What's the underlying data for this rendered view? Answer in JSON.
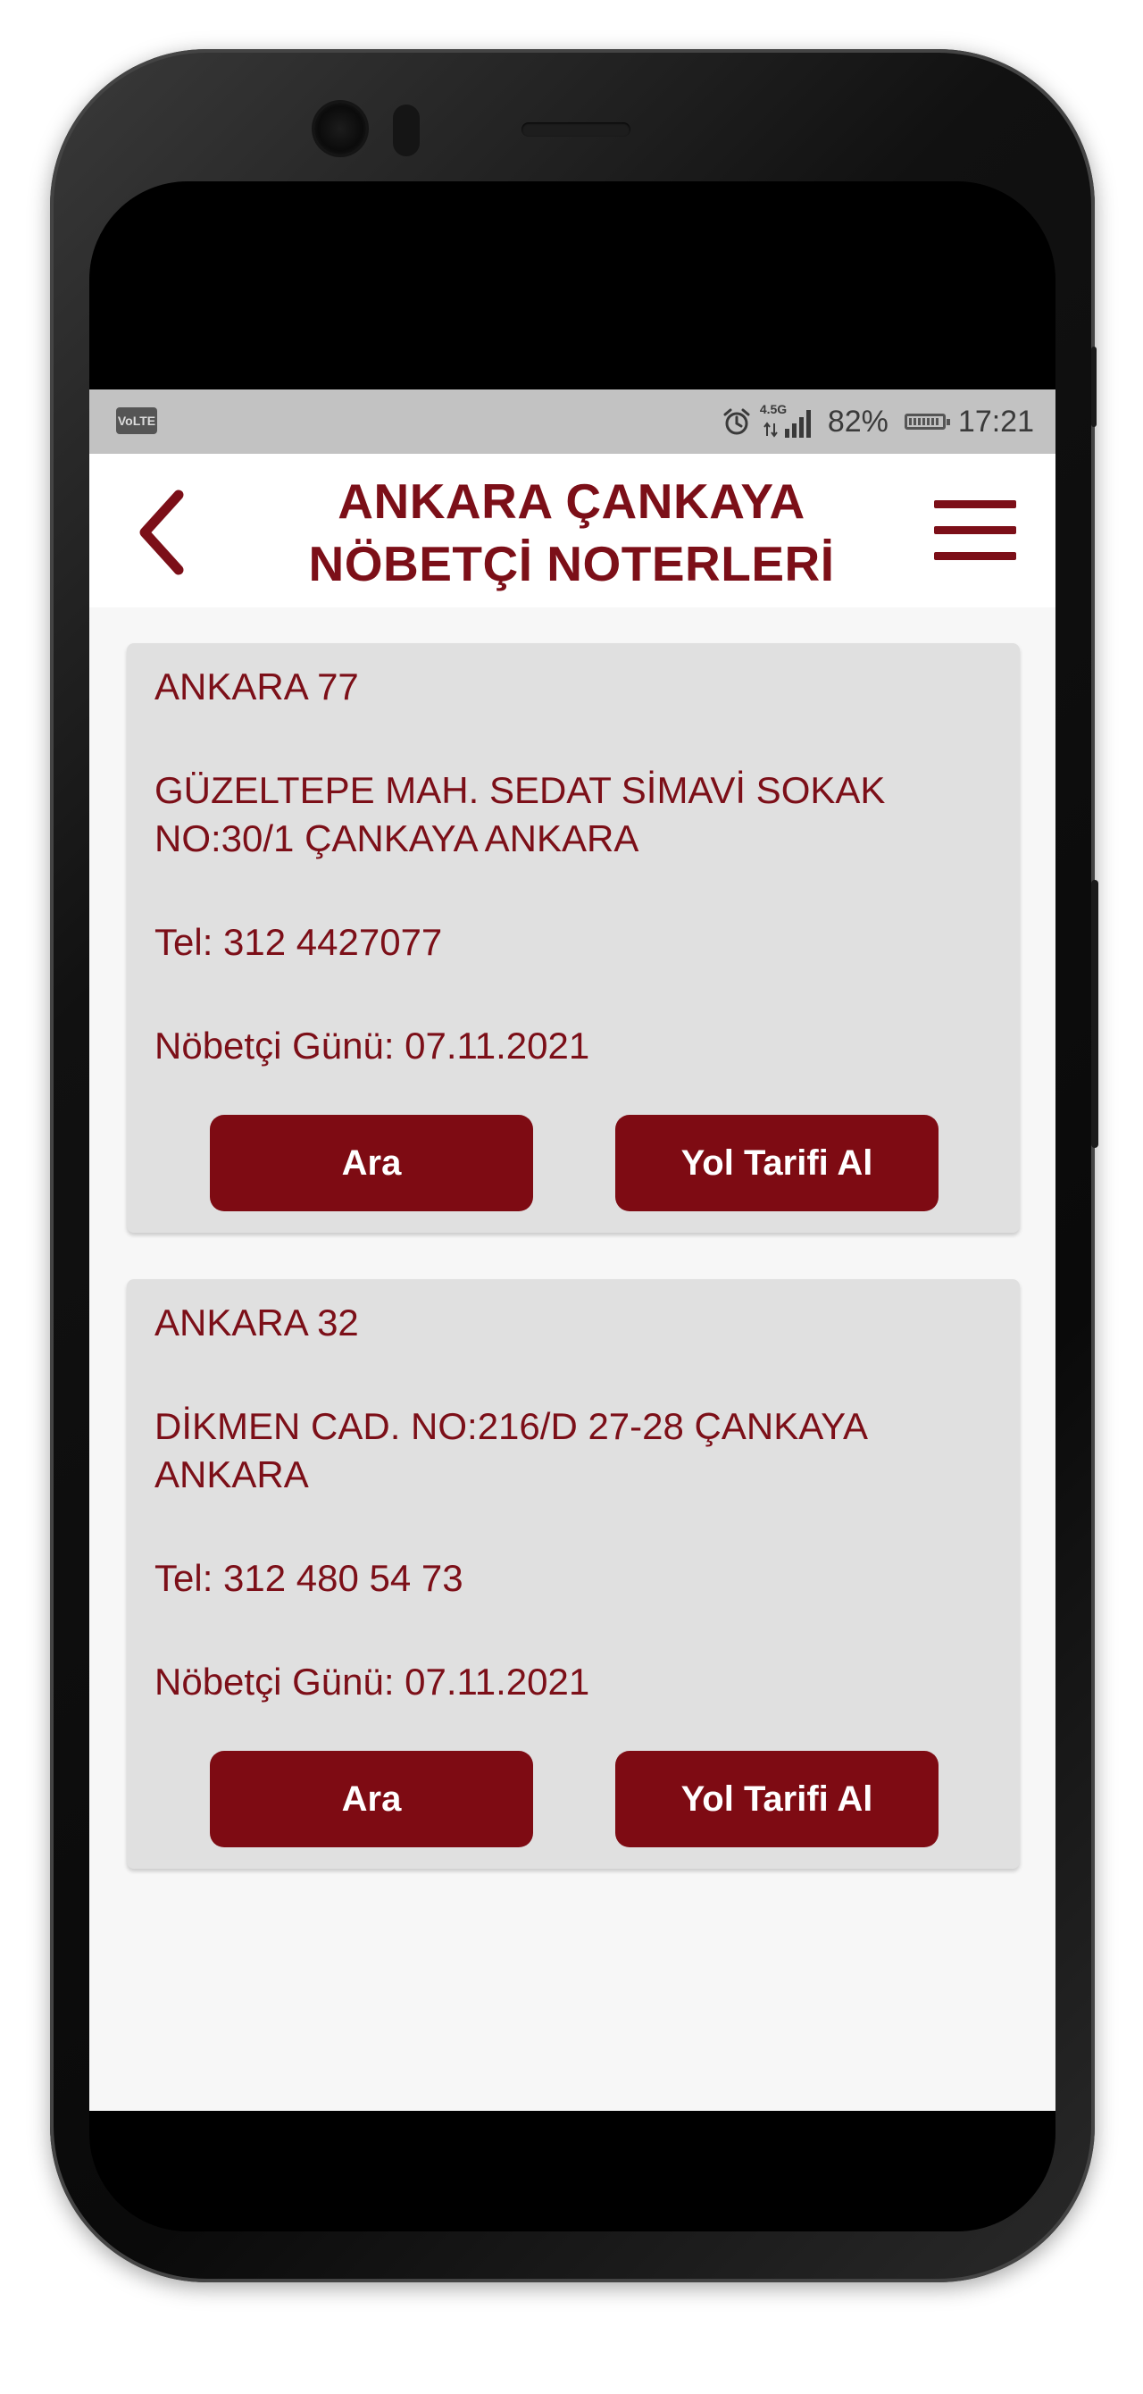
{
  "status_bar": {
    "network_badge": "VoLTE",
    "network_type": "4.5G",
    "battery": "82%",
    "time": "17:21",
    "icons": [
      "alarm-icon",
      "signal-icon",
      "battery-icon"
    ]
  },
  "header": {
    "title_line1": "ANKARA ÇANKAYA",
    "title_line2": "NÖBETÇİ NOTERLERİ",
    "back_icon": "chevron-left-icon",
    "menu_icon": "hamburger-menu-icon"
  },
  "notaries": [
    {
      "name": "ANKARA 77",
      "address_line1": "GÜZELTEPE MAH. SEDAT SİMAVİ SOKAK",
      "address_line2": "NO:30/1 ÇANKAYA ANKARA",
      "phone": "Tel: 312 4427077",
      "duty_day": "Nöbetçi Günü: 07.11.2021",
      "call_label": "Ara",
      "route_label": "Yol Tarifi Al"
    },
    {
      "name": "ANKARA 32",
      "address_line1": "DİKMEN CAD. NO:216/D 27-28 ÇANKAYA",
      "address_line2": "ANKARA",
      "phone": "Tel: 312 480 54 73",
      "duty_day": "Nöbetçi Günü: 07.11.2021",
      "call_label": "Ara",
      "route_label": "Yol Tarifi Al"
    }
  ],
  "colors": {
    "brand": "#7c0f18",
    "button": "#7e0b13",
    "card_bg": "#e0e0e0",
    "status_bar_bg": "#c2c2c2"
  }
}
